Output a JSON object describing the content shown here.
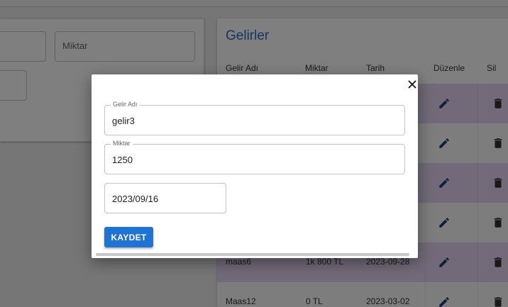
{
  "background_form": {
    "miktar_placeholder": "Miktar"
  },
  "income_list": {
    "title": "Gelirler",
    "columns": [
      "Gelir Adı",
      "Miktar",
      "Tarih",
      "Düzenle",
      "Sil"
    ],
    "rows": [
      {
        "name": "",
        "amount": "",
        "date": ""
      },
      {
        "name": "",
        "amount": "",
        "date": ""
      },
      {
        "name": "",
        "amount": "",
        "date": ""
      },
      {
        "name": "",
        "amount": "",
        "date": ""
      },
      {
        "name": "maas6",
        "amount": "1k 800 TL",
        "date": "2023-09-28"
      },
      {
        "name": "Maas12",
        "amount": "0 TL",
        "date": "2023-03-02"
      }
    ]
  },
  "modal": {
    "close_icon": "close-icon",
    "name_label": "Gelir Adı",
    "name_value": "gelir3",
    "amount_label": "Miktar",
    "amount_value": "1250",
    "date_value": "2023/09/16",
    "save_label": "KAYDET"
  },
  "colors": {
    "accent": "#1f73d1",
    "title": "#2a6cc6",
    "row_highlight": "#e4d4f1"
  }
}
